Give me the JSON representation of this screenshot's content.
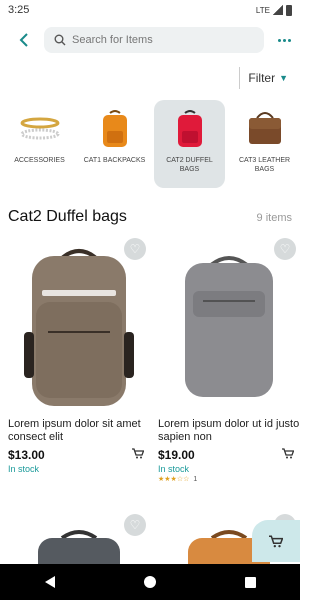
{
  "status": {
    "time": "3:25",
    "network": "LTE"
  },
  "search": {
    "placeholder": "Search for Items"
  },
  "filter": {
    "label": "Filter"
  },
  "categories": [
    {
      "label": "ACCESSORIES",
      "icon": "bracelet-icon"
    },
    {
      "label": "CAT1 BACKPACKS",
      "icon": "orange-backpack-icon"
    },
    {
      "label": "CAT2 DUFFEL BAGS",
      "icon": "red-backpack-icon",
      "selected": true
    },
    {
      "label": "CAT3 LEATHER BAGS",
      "icon": "leather-bag-icon"
    }
  ],
  "section": {
    "title": "Cat2 Duffel bags",
    "count": "9 items"
  },
  "products": [
    {
      "name": "Lorem ipsum dolor sit amet consect elit",
      "price": "$13.00",
      "stock": "In stock"
    },
    {
      "name": "Lorem ipsum dolor ut id justo sapien non",
      "price": "$19.00",
      "stock": "In stock",
      "rating": 3,
      "rating_count": "1"
    }
  ],
  "colors": {
    "accent": "#1a8a8a",
    "selected_bg": "#dfe4e6"
  }
}
